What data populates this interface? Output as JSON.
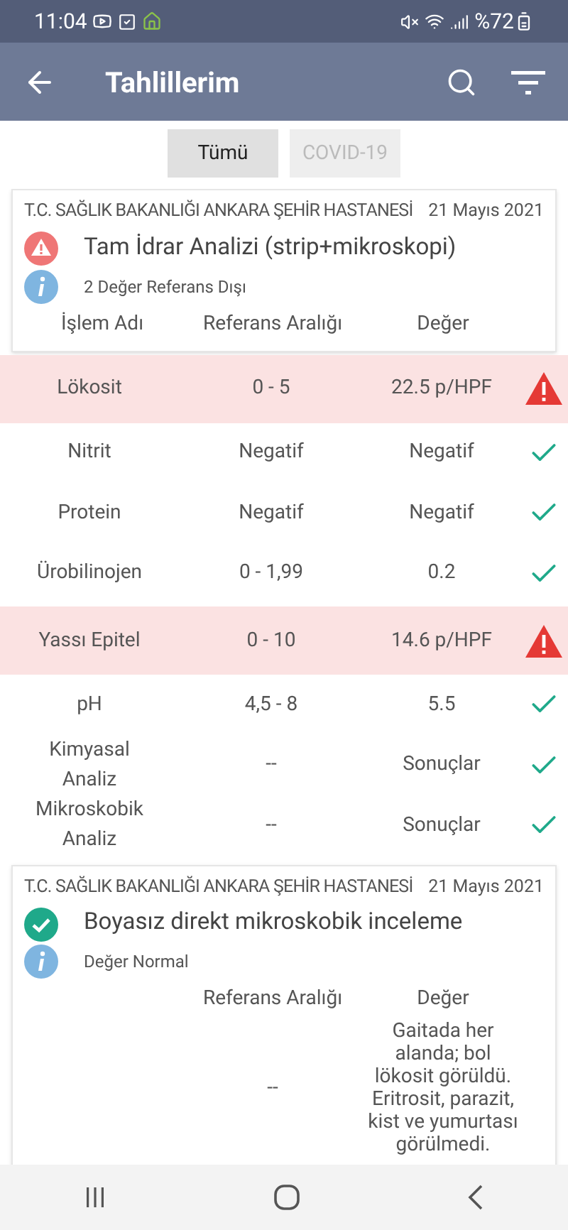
{
  "status_bar": {
    "time": "11:04",
    "battery": "%72"
  },
  "app_bar": {
    "title": "Tahlillerim"
  },
  "tabs": [
    {
      "label": "Tümü",
      "selected": true
    },
    {
      "label": "COVID-19",
      "selected": false
    }
  ],
  "cards": [
    {
      "hospital": "T.C. SAĞLIK BAKANLIĞI ANKARA ŞEHİR HASTANESİ",
      "date": "21 Mayıs 2021",
      "kind": "warning",
      "title": "Tam İdrar Analizi (strip+mikroskopi)",
      "info": "2 Değer Referans Dışı",
      "columns": [
        "İşlem Adı",
        "Referans Aralığı",
        "Değer"
      ],
      "rows": [
        {
          "name": "Lökosit",
          "reference": "0 - 5",
          "value": "22.5 p/HPF",
          "flagged": true
        },
        {
          "name": "Nitrit",
          "reference": "Negatif",
          "value": "Negatif",
          "flagged": false
        },
        {
          "name": "Protein",
          "reference": "Negatif",
          "value": "Negatif",
          "flagged": false
        },
        {
          "name": "Ürobilinojen",
          "reference": "0 - 1,99",
          "value": "0.2",
          "flagged": false
        },
        {
          "name": "Yassı Epitel",
          "reference": "0 - 10",
          "value": "14.6 p/HPF",
          "flagged": true
        },
        {
          "name": "pH",
          "reference": "4,5 - 8",
          "value": "5.5",
          "flagged": false
        },
        {
          "name": "Kimyasal Analiz",
          "reference": "--",
          "value": "Sonuçlar",
          "flagged": false
        },
        {
          "name": "Mikroskobik Analiz",
          "reference": "--",
          "value": "Sonuçlar",
          "flagged": false
        }
      ]
    },
    {
      "hospital": "T.C. SAĞLIK BAKANLIĞI ANKARA ŞEHİR HASTANESİ",
      "date": "21 Mayıs 2021",
      "kind": "ok",
      "title": "Boyasız direkt mikroskobik inceleme",
      "info": "Değer Normal",
      "columns": [
        "Referans Aralığı",
        "Değer"
      ],
      "rows": [
        {
          "reference": "--",
          "value": "Gaitada her alanda; bol lökosit görüldü. Eritrosit, parazit, kist ve yumurtası görülmedi."
        }
      ]
    }
  ]
}
